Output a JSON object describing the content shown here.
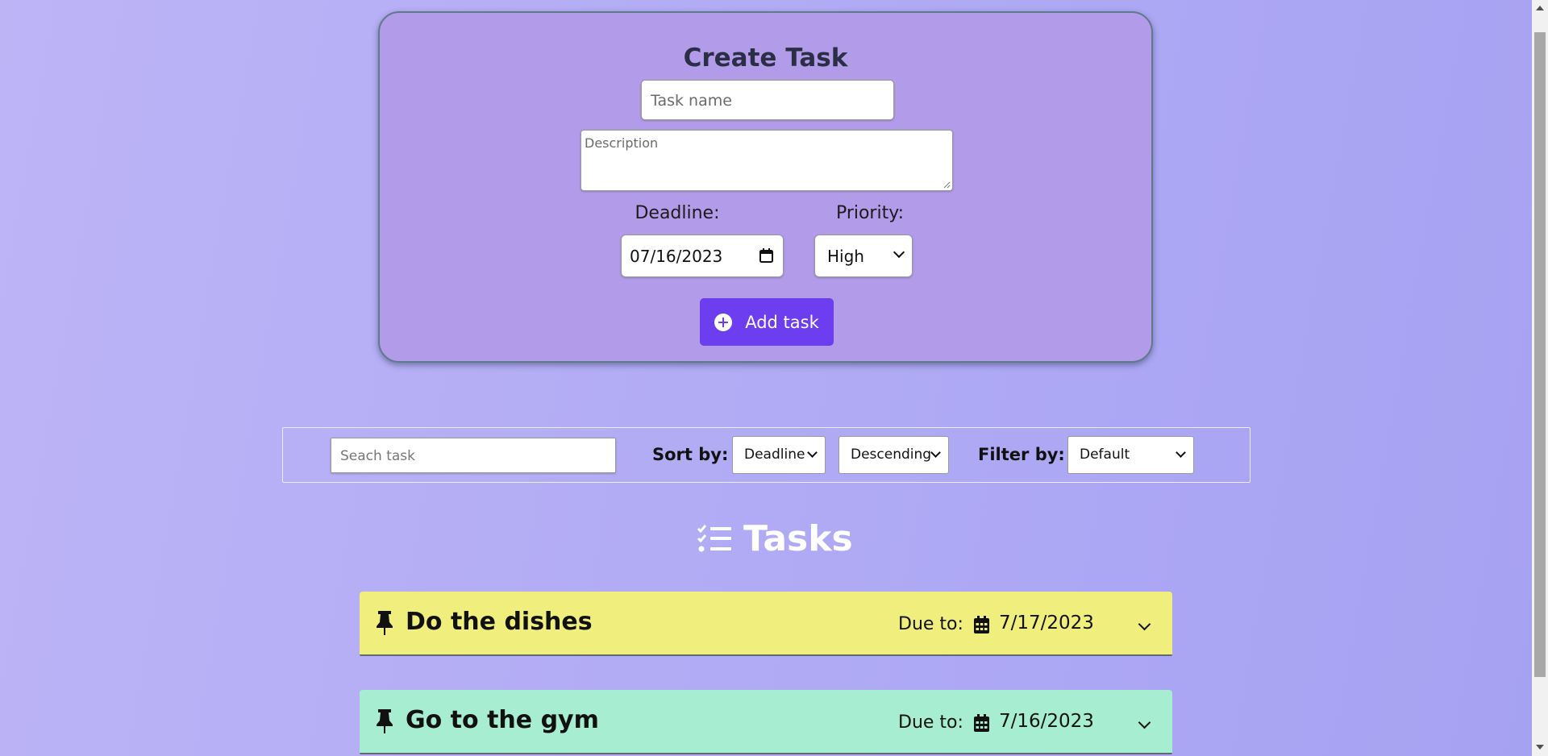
{
  "create_form": {
    "title": "Create Task",
    "task_name_placeholder": "Task name",
    "description_placeholder": "Description",
    "deadline_label": "Deadline:",
    "deadline_value": "07/16/2023",
    "priority_label": "Priority:",
    "priority_value": "High",
    "add_button_label": "Add task"
  },
  "toolbar": {
    "search_placeholder": "Seach task",
    "sort_label": "Sort by:",
    "sort_field_value": "Deadline",
    "sort_order_value": "Descending",
    "filter_label": "Filter by:",
    "filter_value": "Default"
  },
  "tasks_heading": "Tasks",
  "tasks": [
    {
      "title": "Do the dishes",
      "due_label": "Due to:",
      "due_date": "7/17/2023",
      "color": "#f0ef7e"
    },
    {
      "title": "Go to the gym",
      "due_label": "Due to:",
      "due_date": "7/16/2023",
      "color": "#a6edd1"
    }
  ],
  "colors": {
    "accent": "#6c3ef0",
    "panel": "#b29be8"
  }
}
